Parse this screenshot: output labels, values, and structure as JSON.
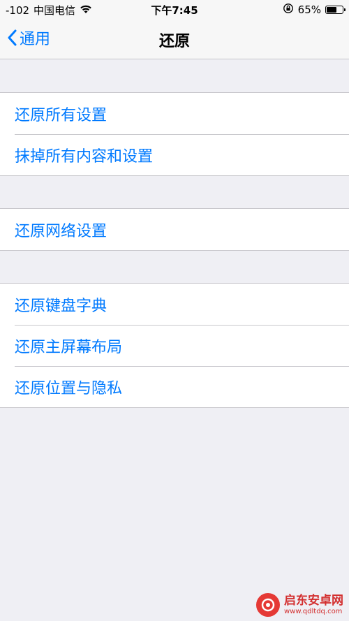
{
  "status_bar": {
    "signal": "-102",
    "carrier": "中国电信",
    "time": "下午7:45",
    "battery_percent": "65%",
    "battery_level": 0.65
  },
  "nav": {
    "back_label": "通用",
    "title": "还原"
  },
  "groups": [
    {
      "items": [
        "还原所有设置",
        "抹掉所有内容和设置"
      ]
    },
    {
      "items": [
        "还原网络设置"
      ]
    },
    {
      "items": [
        "还原键盘字典",
        "还原主屏幕布局",
        "还原位置与隐私"
      ]
    }
  ],
  "watermark": {
    "name": "启东安卓网",
    "url": "www.qdltdq.com"
  },
  "colors": {
    "accent": "#007aff",
    "background": "#efeff4"
  }
}
